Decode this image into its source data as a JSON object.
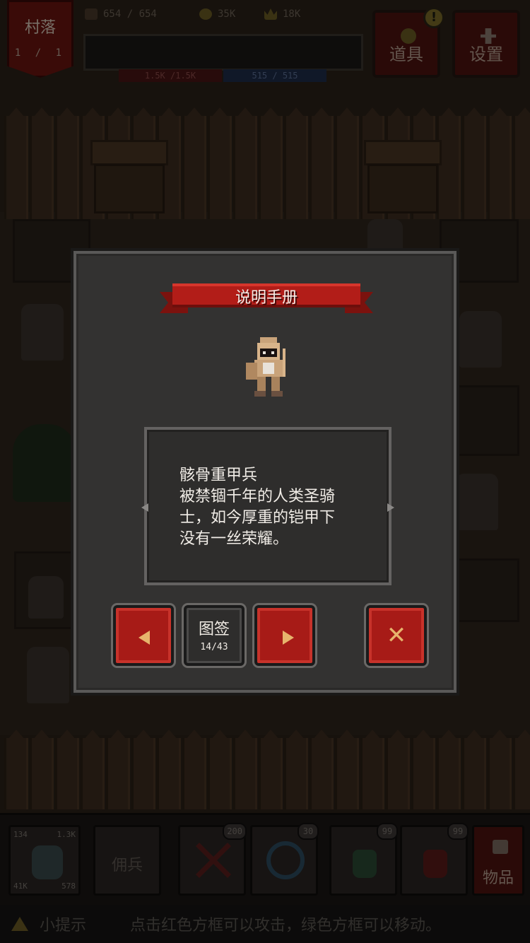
{
  "hud": {
    "village_label": "村落",
    "village_level": "1 / 1",
    "stat_a": "654 / 654",
    "gold": "35K",
    "crown": "18K",
    "hp": "1.5K /1.5K",
    "mp": "515 / 515",
    "items_button": "道具",
    "settings_button": "设置",
    "alert_mark": "!"
  },
  "dialog": {
    "title": "说明手册",
    "monster_name": "骸骨重甲兵",
    "monster_desc_lines": [
      "被禁锢千年的人类圣骑",
      "士，如今厚重的铠甲下",
      "没有一丝荣耀。"
    ],
    "prev_icon": "left-arrow-icon",
    "next_icon": "right-arrow-icon",
    "catalog_label": "图签",
    "catalog_count": "14/43",
    "close_glyph": "✕"
  },
  "bottom": {
    "hero_stats": [
      "134",
      "1.3K",
      "41K",
      "578"
    ],
    "mercenary_slot": "佣兵",
    "skill_a_count": "200",
    "skill_b_count": "30",
    "potion_green_count": "99",
    "potion_red_count": "99",
    "goods_button": "物品",
    "tip_label": "小提示",
    "tip_message": "点击红色方框可以攻击，绿色方框可以移动。"
  },
  "colors": {
    "ribbon_red": "#b21d18",
    "button_red": "#a71b17",
    "arrow_gold": "#e7b46c",
    "dialog_bg": "#333231"
  }
}
